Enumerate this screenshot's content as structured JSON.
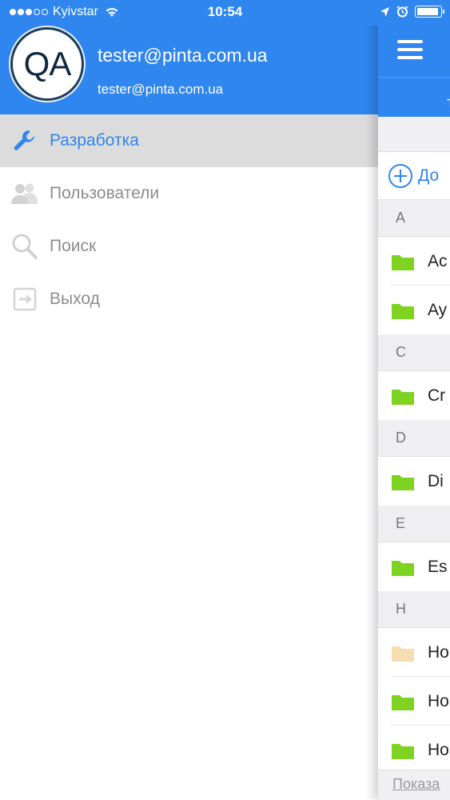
{
  "status_bar": {
    "carrier": "Kyivstar",
    "time": "10:54",
    "signal_bars_filled": 3,
    "signal_bars_total": 5,
    "battery_level": 0.95
  },
  "drawer": {
    "avatar_text": "QA",
    "user_name": "tester@pinta.com.ua",
    "user_email": "tester@pinta.com.ua",
    "items": [
      {
        "label": "Разработка",
        "icon": "wrench-icon",
        "active": true
      },
      {
        "label": "Пользователи",
        "icon": "users-icon",
        "active": false
      },
      {
        "label": "Поиск",
        "icon": "search-icon",
        "active": false
      },
      {
        "label": "Выход",
        "icon": "logout-icon",
        "active": false
      }
    ]
  },
  "main": {
    "subbar_fragment": "Т",
    "add_label": "До",
    "sections": [
      {
        "letter": "A",
        "rows": [
          {
            "label": "Ac",
            "folder": "green"
          },
          {
            "label": "Ay",
            "folder": "green"
          }
        ]
      },
      {
        "letter": "C",
        "rows": [
          {
            "label": "Cr",
            "folder": "green"
          }
        ]
      },
      {
        "letter": "D",
        "rows": [
          {
            "label": "Di",
            "folder": "green"
          }
        ]
      },
      {
        "letter": "E",
        "rows": [
          {
            "label": "Es",
            "folder": "green"
          }
        ]
      },
      {
        "letter": "H",
        "rows": [
          {
            "label": "Ho",
            "folder": "beige"
          },
          {
            "label": "Ho",
            "folder": "green"
          },
          {
            "label": "Ho",
            "folder": "green"
          }
        ]
      }
    ],
    "footer_text": "Показа"
  },
  "colors": {
    "brand_blue": "#2f86ee",
    "folder_green": "#7ed321",
    "folder_beige": "#f7deb0",
    "active_row": "#dcdcdc"
  }
}
